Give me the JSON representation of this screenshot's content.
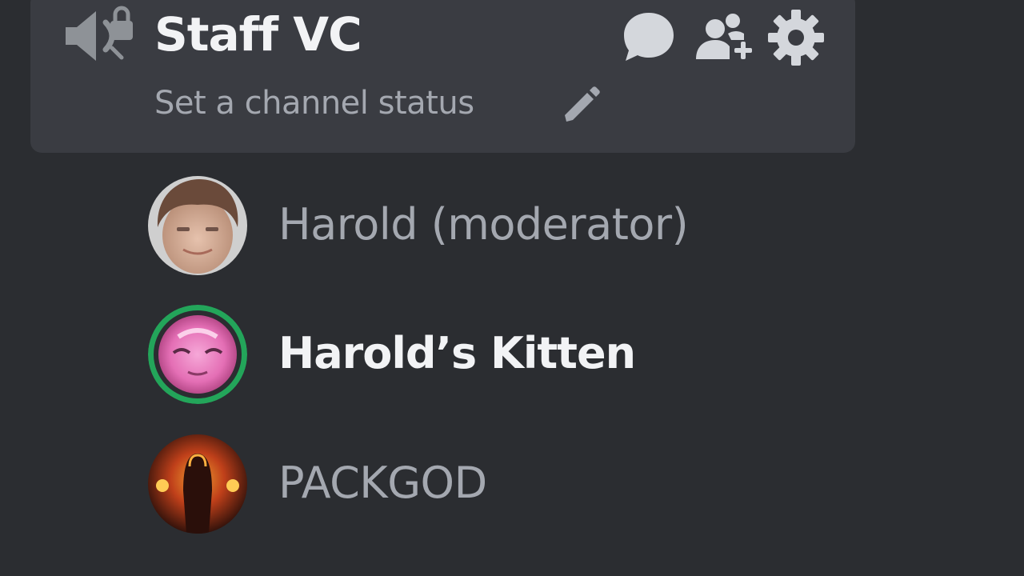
{
  "channel": {
    "name": "Staff VC",
    "status_placeholder": "Set a channel status",
    "icon": "speaker-lock-icon",
    "actions": [
      {
        "name": "open-chat-button",
        "icon": "chat-bubble-icon"
      },
      {
        "name": "invite-button",
        "icon": "add-people-icon"
      },
      {
        "name": "settings-button",
        "icon": "gear-icon"
      }
    ]
  },
  "members": [
    {
      "name": "Harold (moderator)",
      "avatar": "avatar-harold",
      "speaking": false
    },
    {
      "name": "Harold’s Kitten",
      "avatar": "avatar-kitten",
      "speaking": true
    },
    {
      "name": "PACKGOD",
      "avatar": "avatar-packgod",
      "speaking": false
    }
  ],
  "colors": {
    "background": "#2b2d31",
    "card": "#3a3c42",
    "text_muted": "#a4a8b0",
    "text_strong": "#f2f3f5",
    "speaking_ring": "#23a55a"
  }
}
